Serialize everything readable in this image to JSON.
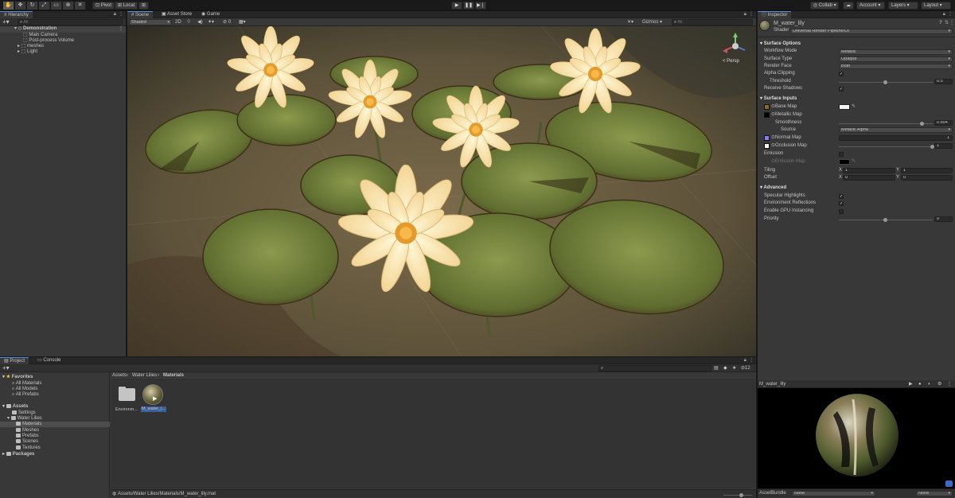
{
  "toolbar": {
    "pivot": "Pivot",
    "local": "Local",
    "collab": "Collab ▾",
    "account": "Account",
    "layers": "Layers",
    "layout": "Layout"
  },
  "hierarchy": {
    "tab": "Hierarchy",
    "search_placeholder": "All",
    "root": "Demonstration",
    "items": [
      "Main Camera",
      "Post-process Volume",
      "meshes",
      "Light"
    ]
  },
  "scene": {
    "tabs": [
      "Scene",
      "Asset Store",
      "Game"
    ],
    "shading_mode": "Shaded",
    "mode_2d": "2D",
    "gizmos": "Gizmos",
    "search_placeholder": "All",
    "camera_label": "< Persp",
    "hidden_count": "0"
  },
  "project": {
    "tabs": [
      "Project",
      "Console"
    ],
    "favorites_label": "Favorites",
    "favorites": [
      "All Materials",
      "All Models",
      "All Prefabs"
    ],
    "assets_label": "Assets",
    "assets_children": [
      "Settings",
      "Water Lilies"
    ],
    "water_lilies_children": [
      "Materials",
      "Meshes",
      "Prefabs",
      "Scenes",
      "Textures"
    ],
    "packages_label": "Packages",
    "breadcrumb": [
      "Assets",
      "Water Lilies",
      "Materials"
    ],
    "grid_items": [
      "Environm...",
      "M_water_l..."
    ],
    "status_path": "Assets/Water Lilies/Materials/M_water_lily.mat",
    "hidden_count": "12"
  },
  "inspector": {
    "tab": "Inspector",
    "material_name": "M_water_lily",
    "shader_label": "Shader",
    "shader_value": "Universal Render Pipeline/Lit",
    "surface_options": "Surface Options",
    "workflow_mode_label": "Workflow Mode",
    "workflow_mode": "Metallic",
    "surface_type_label": "Surface Type",
    "surface_type": "Opaque",
    "render_face_label": "Render Face",
    "render_face": "Both",
    "alpha_clipping_label": "Alpha Clipping",
    "threshold_label": "Threshold",
    "threshold": "0.5",
    "threshold_fraction": 0.5,
    "receive_shadows_label": "Receive Shadows",
    "surface_inputs": "Surface Inputs",
    "base_map_label": "Base Map",
    "metallic_map_label": "Metallic Map",
    "smoothness_label": "Smoothness",
    "smoothness": "0.894",
    "smoothness_fraction": 0.894,
    "source_label": "Source",
    "source": "Metallic Alpha",
    "normal_map_label": "Normal Map",
    "normal_scale": "1",
    "occlusion_map_label": "Occlusion Map",
    "occlusion": "1",
    "occlusion_fraction": 1.0,
    "emission_label": "Emission",
    "emission_map_label": "Emission Map",
    "tiling_label": "Tiling",
    "tiling_x": "1",
    "tiling_y": "1",
    "offset_label": "Offset",
    "offset_x": "0",
    "offset_y": "0",
    "advanced": "Advanced",
    "specular_label": "Specular Highlights",
    "env_reflections_label": "Environment Reflections",
    "gpu_instancing_label": "Enable GPU Instancing",
    "priority_label": "Priority",
    "priority": "0",
    "priority_fraction": 0.5,
    "preview_title": "M_water_lily",
    "asset_bundle_label": "AssetBundle",
    "asset_bundle": "None",
    "asset_bundle_variant": "None",
    "axis_x": "X",
    "axis_y": "Y"
  },
  "colors": {
    "accent": "#5a8ee0",
    "panel": "#383838",
    "dark": "#191919",
    "normal_map_swatch": "#8080ff"
  }
}
